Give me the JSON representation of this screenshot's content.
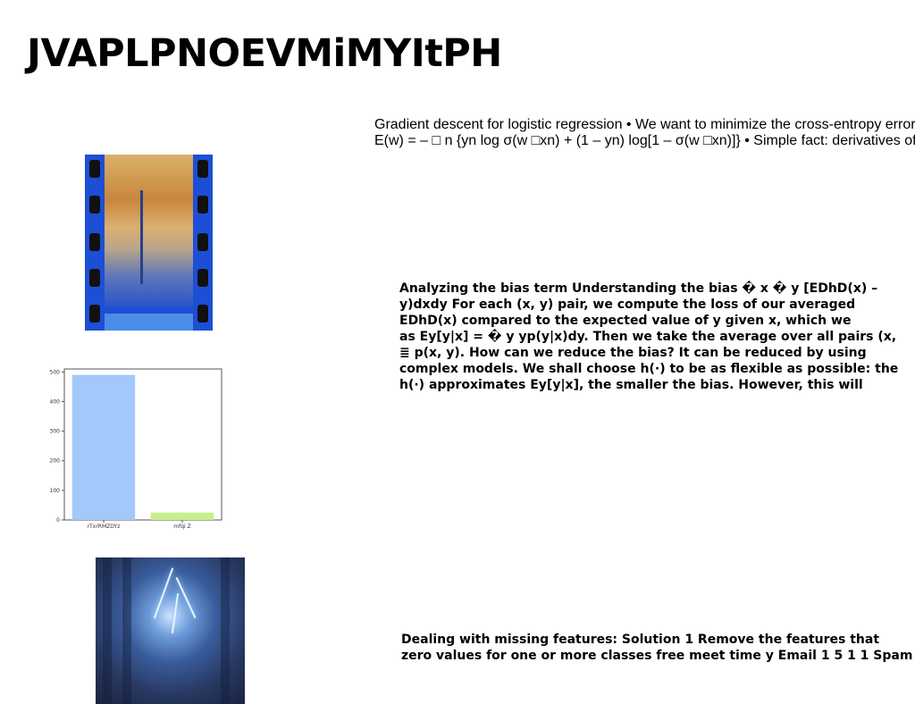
{
  "title": "JVAPLPNOEVMiMYItPH",
  "block_a": {
    "lines": [
      "Gradient descent for logistic regression • We want to minimize the cross-entropy error",
      "E(w) = – □ n {yn log σ(w □xn) + (1 – yn) log[1 – σ(w □xn)]} • Simple fact: derivatives of"
    ]
  },
  "block_b": {
    "lines": [
      "Analyzing the bias term Understanding the bias � x � y [EDhD(x) –",
      "y)dxdy For each (x, y) pair, we compute the loss of our averaged",
      "EDhD(x) compared to the expected value of y given x, which we",
      "as Ey[y|x] = � y yp(y|x)dy. Then we take the average over all pairs (x,",
      "≣ p(x, y). How can we reduce the bias? It can be reduced by using",
      "complex models. We shall choose h(·) to be as flexible as possible: the",
      "h(·) approximates Ey[y|x], the smaller the bias. However, this will"
    ]
  },
  "block_c": {
    "lines": [
      "Dealing with missing features: Solution 1 Remove the features that",
      "zero values for one or more classes free meet time y Email 1 5 1 1 Spam"
    ]
  },
  "chart_data": {
    "type": "bar",
    "categories": [
      "rTxrRMZDYz",
      "mfqi Z"
    ],
    "values": [
      490,
      25
    ],
    "colors": [
      "#a3c8fb",
      "#c8f08c"
    ],
    "ylim": [
      0,
      510
    ],
    "yticks": [
      0,
      100,
      200,
      300,
      400,
      500
    ],
    "title": "",
    "xlabel": "",
    "ylabel": ""
  }
}
